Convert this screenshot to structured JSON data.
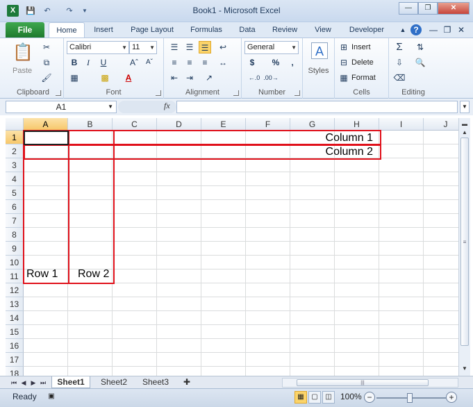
{
  "window": {
    "title": "Book1  -  Microsoft Excel",
    "logo": "X"
  },
  "ribbon_tabs": [
    "File",
    "Home",
    "Insert",
    "Page Layout",
    "Formulas",
    "Data",
    "Review",
    "View",
    "Developer"
  ],
  "clipboard": {
    "paste": "Paste",
    "label": "Clipboard"
  },
  "font": {
    "name": "Calibri",
    "size": "11",
    "label": "Font",
    "bold": "B",
    "italic": "I",
    "underline": "U"
  },
  "alignment": {
    "label": "Alignment"
  },
  "number": {
    "format": "General",
    "label": "Number",
    "currency": "$",
    "percent": "%",
    "comma": ","
  },
  "styles": {
    "label": "Styles"
  },
  "cells": {
    "insert": "Insert",
    "delete": "Delete",
    "format": "Format",
    "label": "Cells"
  },
  "editing": {
    "label": "Editing"
  },
  "formula_bar": {
    "name_box": "A1",
    "fx": "fx",
    "value": ""
  },
  "columns": [
    "A",
    "B",
    "C",
    "D",
    "E",
    "F",
    "G",
    "H",
    "I",
    "J"
  ],
  "rows": [
    "1",
    "2",
    "3",
    "4",
    "5",
    "6",
    "7",
    "8",
    "9",
    "10",
    "11",
    "12",
    "13",
    "14",
    "15",
    "16",
    "17",
    "18"
  ],
  "cells_text": {
    "h1": "Column 1",
    "h2": "Column 2",
    "a11": "Row 1",
    "b11": "Row 2"
  },
  "sheets": [
    "Sheet1",
    "Sheet2",
    "Sheet3"
  ],
  "status": {
    "ready": "Ready",
    "zoom": "100%"
  },
  "colors": {
    "accent_green": "#1d7a3a",
    "annotation_red": "#e0101a",
    "ribbon_blue": "#dfe9f5"
  }
}
